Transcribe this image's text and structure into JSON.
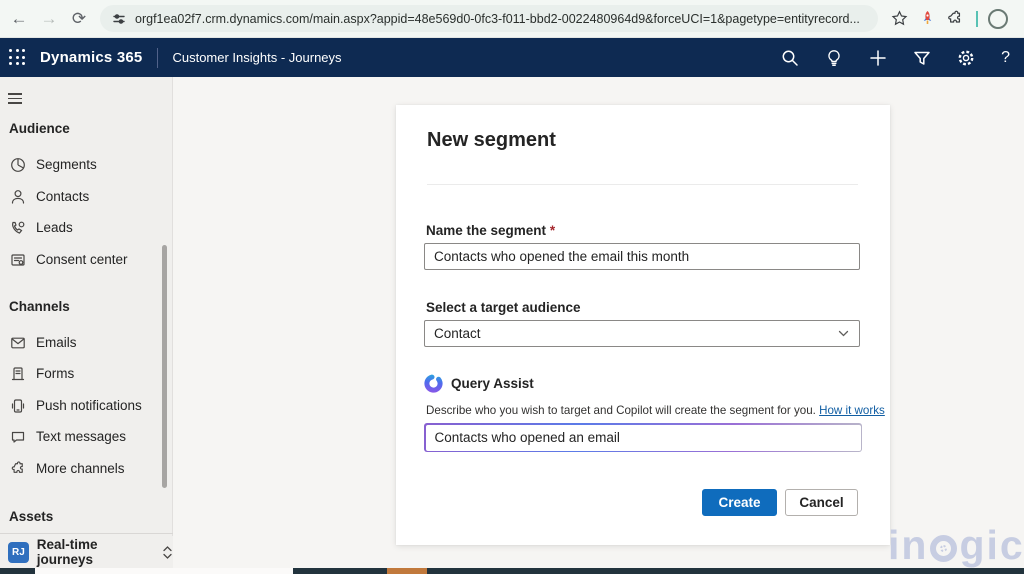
{
  "browser": {
    "url": "orgf1ea02f7.crm.dynamics.com/main.aspx?appid=48e569d0-0fc3-f011-bbd2-0022480964d9&forceUCI=1&pagetype=entityrecord...",
    "back_glyph": "←",
    "forward_glyph": "→",
    "reload_glyph": "⟳"
  },
  "topnav": {
    "brand": "Dynamics 365",
    "app": "Customer Insights - Journeys",
    "icons": [
      "search-icon",
      "lightbulb-icon",
      "plus-icon",
      "filter-icon",
      "gear-icon",
      "help-icon"
    ]
  },
  "sidebar": {
    "audience": {
      "header": "Audience",
      "items": [
        {
          "label": "Segments",
          "icon": "segments-icon"
        },
        {
          "label": "Contacts",
          "icon": "contacts-icon"
        },
        {
          "label": "Leads",
          "icon": "leads-icon"
        },
        {
          "label": "Consent center",
          "icon": "consent-center-icon"
        }
      ]
    },
    "channels": {
      "header": "Channels",
      "items": [
        {
          "label": "Emails",
          "icon": "email-icon"
        },
        {
          "label": "Forms",
          "icon": "form-icon"
        },
        {
          "label": "Push notifications",
          "icon": "push-notification-icon"
        },
        {
          "label": "Text messages",
          "icon": "text-message-icon"
        },
        {
          "label": "More channels",
          "icon": "puzzle-icon"
        }
      ]
    },
    "assets": {
      "header": "Assets"
    },
    "area_switcher": {
      "initials": "RJ",
      "label": "Real-time journeys"
    }
  },
  "dialog": {
    "title": "New segment",
    "name_field": {
      "label": "Name the segment",
      "required_mark": "*",
      "value": "Contacts who opened the email this month"
    },
    "audience_field": {
      "label": "Select a target audience",
      "value": "Contact"
    },
    "query_assist": {
      "title": "Query Assist",
      "icon": "copilot-icon",
      "description": "Describe who you wish to target and Copilot will create the segment for you.",
      "link": "How it works",
      "value": "Contacts who opened an email"
    },
    "buttons": {
      "create": "Create",
      "cancel": "Cancel"
    }
  },
  "watermark": {
    "left": "in",
    "right": "gic"
  },
  "colors": {
    "accent": "#0f6cbd",
    "topnav_bg": "#0e2a52",
    "sidebar_bg": "#f0efed",
    "required": "#a4262c",
    "link": "#115ea3",
    "strip_dark": "#22333d",
    "strip_orange": "#c1793c"
  }
}
